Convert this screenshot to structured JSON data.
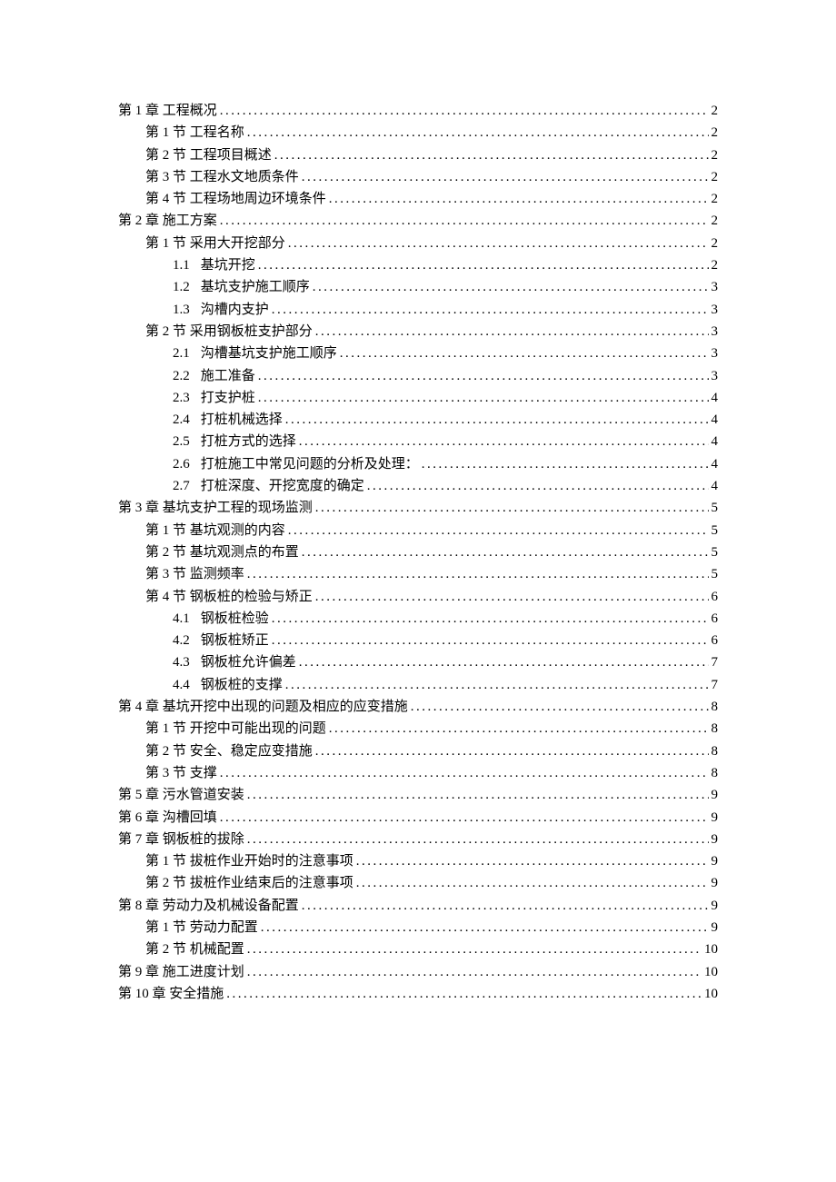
{
  "toc": [
    {
      "level": 0,
      "num": "",
      "label": "第 1 章 工程概况",
      "page": "2"
    },
    {
      "level": 1,
      "num": "",
      "label": "第 1 节 工程名称",
      "page": "2"
    },
    {
      "level": 1,
      "num": "",
      "label": "第 2 节 工程项目概述",
      "page": "2"
    },
    {
      "level": 1,
      "num": "",
      "label": "第 3 节 工程水文地质条件",
      "page": "2"
    },
    {
      "level": 1,
      "num": "",
      "label": "第 4 节 工程场地周边环境条件",
      "page": "2"
    },
    {
      "level": 0,
      "num": "",
      "label": "第 2 章 施工方案",
      "page": "2"
    },
    {
      "level": 1,
      "num": "",
      "label": "第 1 节 采用大开挖部分",
      "page": "2"
    },
    {
      "level": 2,
      "num": "1.1",
      "label": "基坑开挖",
      "page": "2"
    },
    {
      "level": 2,
      "num": "1.2",
      "label": "基坑支护施工顺序",
      "page": "3"
    },
    {
      "level": 2,
      "num": "1.3",
      "label": "沟槽内支护",
      "page": "3"
    },
    {
      "level": 1,
      "num": "",
      "label": "第 2 节 采用钢板桩支护部分",
      "page": "3"
    },
    {
      "level": 2,
      "num": "2.1",
      "label": "沟槽基坑支护施工顺序",
      "page": "3"
    },
    {
      "level": 2,
      "num": "2.2",
      "label": "施工准备",
      "page": "3"
    },
    {
      "level": 2,
      "num": "2.3",
      "label": "打支护桩",
      "page": "4"
    },
    {
      "level": 2,
      "num": "2.4",
      "label": "打桩机械选择",
      "page": "4"
    },
    {
      "level": 2,
      "num": "2.5",
      "label": "打桩方式的选择",
      "page": "4"
    },
    {
      "level": 2,
      "num": "2.6",
      "label": "打桩施工中常见问题的分析及处理：",
      "page": "4"
    },
    {
      "level": 2,
      "num": "2.7",
      "label": "打桩深度、开挖宽度的确定",
      "page": "4"
    },
    {
      "level": 0,
      "num": "",
      "label": "第 3 章 基坑支护工程的现场监测",
      "page": "5"
    },
    {
      "level": 1,
      "num": "",
      "label": "第 1 节 基坑观测的内容",
      "page": "5"
    },
    {
      "level": 1,
      "num": "",
      "label": "第 2 节 基坑观测点的布置",
      "page": "5"
    },
    {
      "level": 1,
      "num": "",
      "label": "第 3 节 监测频率",
      "page": "5"
    },
    {
      "level": 1,
      "num": "",
      "label": "第 4 节 钢板桩的检验与矫正",
      "page": "6"
    },
    {
      "level": 2,
      "num": "4.1",
      "label": "钢板桩检验",
      "page": "6"
    },
    {
      "level": 2,
      "num": "4.2",
      "label": "钢板桩矫正",
      "page": "6"
    },
    {
      "level": 2,
      "num": "4.3",
      "label": "钢板桩允许偏差",
      "page": "7"
    },
    {
      "level": 2,
      "num": "4.4",
      "label": "钢板桩的支撑",
      "page": "7"
    },
    {
      "level": 0,
      "num": "",
      "label": "第 4 章 基坑开挖中出现的问题及相应的应变措施",
      "page": "8"
    },
    {
      "level": 1,
      "num": "",
      "label": "第 1 节 开挖中可能出现的问题",
      "page": "8"
    },
    {
      "level": 1,
      "num": "",
      "label": "第 2 节 安全、稳定应变措施",
      "page": "8"
    },
    {
      "level": 1,
      "num": "",
      "label": "第 3 节 支撑",
      "page": "8"
    },
    {
      "level": 0,
      "num": "",
      "label": "第 5 章 污水管道安装",
      "page": "9"
    },
    {
      "level": 0,
      "num": "",
      "label": "第 6 章 沟槽回填",
      "page": "9"
    },
    {
      "level": 0,
      "num": "",
      "label": "第 7 章 钢板桩的拔除",
      "page": "9"
    },
    {
      "level": 1,
      "num": "",
      "label": "第 1 节 拔桩作业开始时的注意事项",
      "page": "9"
    },
    {
      "level": 1,
      "num": "",
      "label": "第 2 节 拔桩作业结束后的注意事项",
      "page": "9"
    },
    {
      "level": 0,
      "num": "",
      "label": "第 8 章 劳动力及机械设备配置",
      "page": "9"
    },
    {
      "level": 1,
      "num": "",
      "label": "第 1 节 劳动力配置",
      "page": "9"
    },
    {
      "level": 1,
      "num": "",
      "label": "第 2 节 机械配置",
      "page": "10"
    },
    {
      "level": 0,
      "num": "",
      "label": "第 9 章 施工进度计划",
      "page": "10"
    },
    {
      "level": 0,
      "num": "",
      "label": "第 10 章 安全措施",
      "page": "10"
    }
  ]
}
